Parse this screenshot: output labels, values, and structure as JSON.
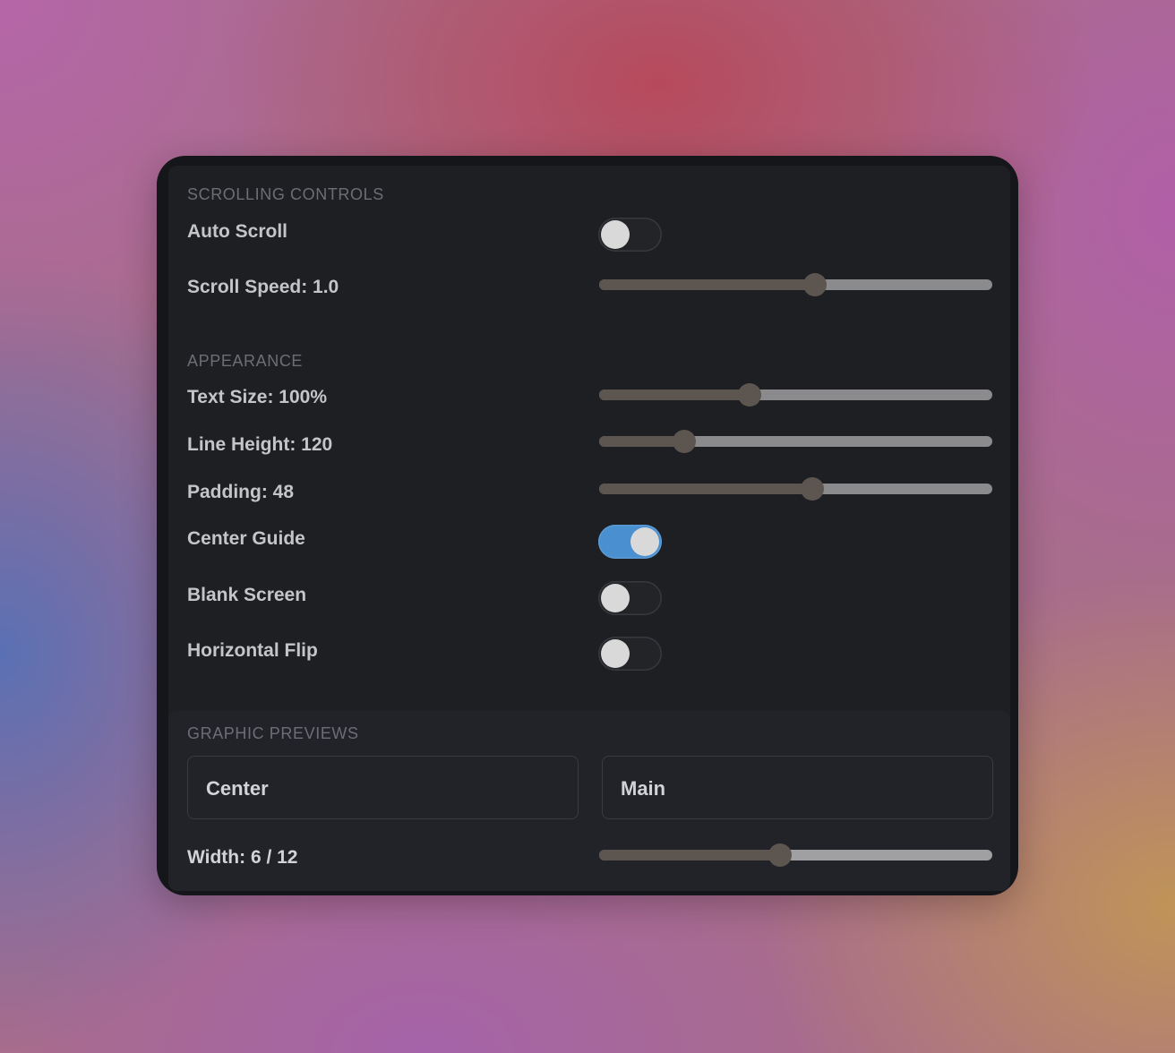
{
  "sections": {
    "scrolling": {
      "title": "SCROLLING CONTROLS",
      "auto_scroll": {
        "label": "Auto Scroll",
        "on": false
      },
      "scroll_speed": {
        "label": "Scroll Speed: 1.0",
        "fraction": 0.548
      }
    },
    "appearance": {
      "title": "APPEARANCE",
      "text_size": {
        "label": "Text Size: 100%",
        "fraction": 0.383
      },
      "line_height": {
        "label": "Line Height: 120",
        "fraction": 0.217
      },
      "padding": {
        "label": "Padding: 48",
        "fraction": 0.543
      },
      "center_guide": {
        "label": "Center Guide",
        "on": true
      },
      "blank_screen": {
        "label": "Blank Screen",
        "on": false
      },
      "horizontal_flip": {
        "label": "Horizontal Flip",
        "on": false
      }
    },
    "graphic_previews": {
      "title": "GRAPHIC PREVIEWS",
      "buttons": [
        "Center",
        "Main"
      ],
      "width": {
        "label": "Width: 6 / 12",
        "fraction": 0.459
      }
    }
  },
  "colors": {
    "toggle_on": "#4a8fcf",
    "slider_fill": "#5c5550",
    "slider_track": "#8b8b8d"
  }
}
